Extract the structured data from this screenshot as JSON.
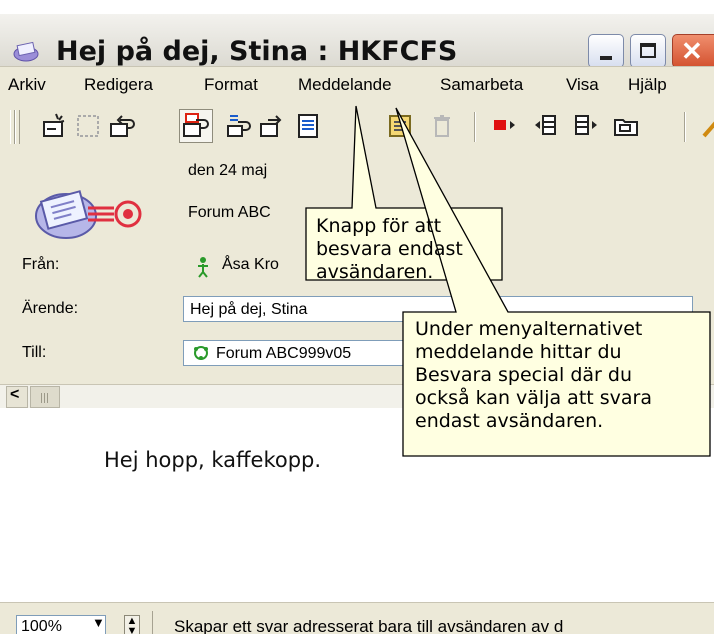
{
  "window": {
    "title": "Hej på dej, Stina : HKFCFS",
    "icon": "mail-envelope-icon"
  },
  "menu": [
    "Arkiv",
    "Redigera",
    "Format",
    "Meddelande",
    "Samarbeta",
    "Visa",
    "Hjälp"
  ],
  "toolbar": {
    "buttons": [
      "new-message-icon",
      "save-icon",
      "reply-icon",
      "reply-sender-icon",
      "reply-all-icon",
      "forward-icon",
      "print-icon",
      "note-icon",
      "delete-icon",
      "flag-icon",
      "previous-icon",
      "next-icon",
      "folder-icon"
    ]
  },
  "header": {
    "date": "den 24 maj",
    "forum": "Forum ABC",
    "from_label": "Från:",
    "from_value": "Åsa Kro",
    "subject_label": "Ärende:",
    "subject_value": "Hej på dej, Stina",
    "to_label": "Till:",
    "to_value": "Forum ABC999v05"
  },
  "body": {
    "text": "Hej hopp, kaffekopp."
  },
  "statusbar": {
    "zoom": "100%",
    "text": "Skapar ett svar adresserat bara till avsändaren av d"
  },
  "callouts": {
    "reply_sender": "Knapp för att\nbesvara endast\navsändaren.",
    "menu_hint": "Under menyalternativet\nmeddelande hittar du\nBesvara special där du\nockså kan välja att svara\nendast avsändaren."
  },
  "colors": {
    "chrome": "#ece9d8",
    "callout_fill": "#ffffe1",
    "close_button": "#d3512f",
    "flag": "#e01010"
  }
}
